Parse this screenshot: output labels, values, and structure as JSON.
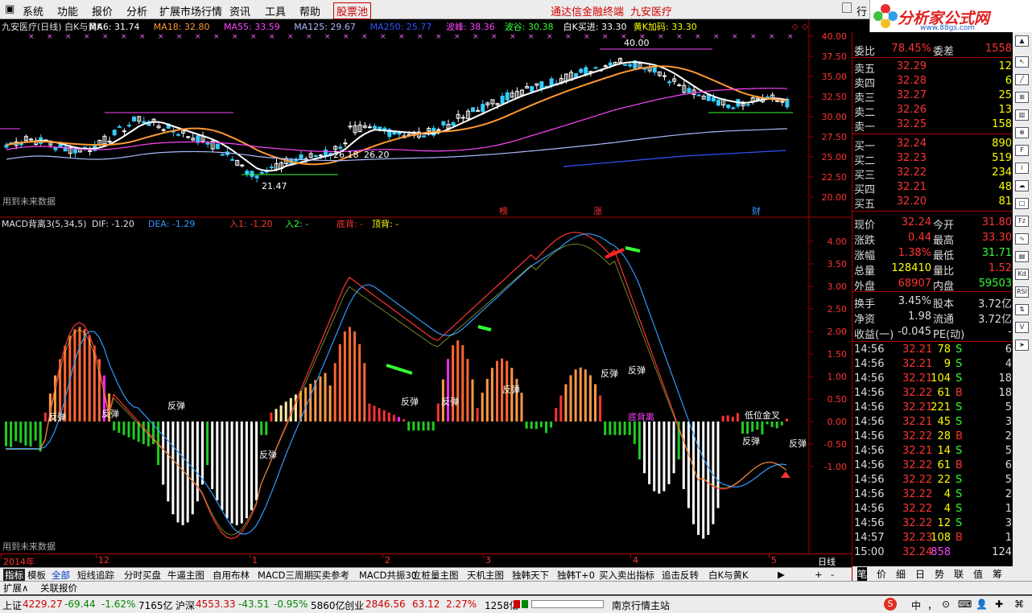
{
  "menu": [
    "系统",
    "功能",
    "报价",
    "分析",
    "扩展市场行情",
    "资讯",
    "工具",
    "帮助",
    "股票池"
  ],
  "menu_center": "通达信金融终端",
  "menu_stock": "九安医疗",
  "menu_right": "行",
  "logo": {
    "text": "分析家公式网",
    "sub": "www.88gs.com"
  },
  "price_header": [
    {
      "t": "九安医疗(日线) 白K与黄K",
      "c": "#e0e0e0"
    },
    {
      "t": "MA6: 31.74",
      "c": "#ffffff"
    },
    {
      "t": "MA18: 32.80",
      "c": "#ff9933"
    },
    {
      "t": "MA55: 33.59",
      "c": "#ff44ff"
    },
    {
      "t": "MA125: 29.67",
      "c": "#aabbff"
    },
    {
      "t": "MA250: 25.77",
      "c": "#3355ff"
    },
    {
      "t": "波峰: 38.36",
      "c": "#ff44ff"
    },
    {
      "t": "波谷: 30.38",
      "c": "#33ff33"
    },
    {
      "t": "白K买进: 33.30",
      "c": "#ffffff"
    },
    {
      "t": "黄K加码: 33.30",
      "c": "#ffff00"
    }
  ],
  "price_axis": [
    "40.00",
    "37.50",
    "35.00",
    "32.50",
    "30.00",
    "27.50",
    "25.00",
    "22.50",
    "20.00"
  ],
  "price_annotations": {
    "high": "40.00",
    "low": "21.47",
    "mid1": "26.18",
    "mid2": "26.20",
    "future": "用到未来数据",
    "b1": "榜",
    "b2": "涨",
    "b3": "财"
  },
  "macd_header": [
    {
      "t": "MACD背离3(5,34,5)",
      "c": "#e0e0e0"
    },
    {
      "t": "DIF: -1.20",
      "c": "#e0e0e0"
    },
    {
      "t": "DEA: -1.29",
      "c": "#3399ff"
    },
    {
      "t": "入1: -1.20",
      "c": "#ff3333"
    },
    {
      "t": "入2: -",
      "c": "#33ff33"
    },
    {
      "t": "底背: -",
      "c": "#ff3333"
    },
    {
      "t": "顶背: -",
      "c": "#ffff00"
    }
  ],
  "macd_axis": [
    "4.00",
    "3.50",
    "3.00",
    "2.50",
    "2.00",
    "1.50",
    "1.00",
    "0.50",
    "0.00",
    "-0.50",
    "-1.00"
  ],
  "macd_annotations": {
    "rebound": "反弹",
    "bottom": "底背离",
    "golden": "低位金叉",
    "future": "用到未来数据"
  },
  "date_axis": [
    "2014年",
    "12",
    "1",
    "2",
    "3",
    "4",
    "5"
  ],
  "period": "日线",
  "quote": {
    "wei_bi_label": "委比",
    "wei_bi": "78.45%",
    "wei_cha_label": "委差",
    "wei_cha": "1558",
    "asks": [
      {
        "l": "卖五",
        "p": "32.29",
        "v": "12"
      },
      {
        "l": "卖四",
        "p": "32.28",
        "v": "6"
      },
      {
        "l": "卖三",
        "p": "32.27",
        "v": "25"
      },
      {
        "l": "卖二",
        "p": "32.26",
        "v": "13"
      },
      {
        "l": "卖一",
        "p": "32.25",
        "v": "158"
      }
    ],
    "bids": [
      {
        "l": "买一",
        "p": "32.24",
        "v": "890"
      },
      {
        "l": "买二",
        "p": "32.23",
        "v": "519"
      },
      {
        "l": "买三",
        "p": "32.22",
        "v": "234"
      },
      {
        "l": "买四",
        "p": "32.21",
        "v": "48"
      },
      {
        "l": "买五",
        "p": "32.20",
        "v": "81"
      }
    ],
    "stats": [
      {
        "l1": "现价",
        "v1": "32.24",
        "c1": "#ff3333",
        "l2": "今开",
        "v2": "31.80",
        "c2": "#ff3333"
      },
      {
        "l1": "涨跌",
        "v1": "0.44",
        "c1": "#ff3333",
        "l2": "最高",
        "v2": "33.30",
        "c2": "#ff3333"
      },
      {
        "l1": "涨幅",
        "v1": "1.38%",
        "c1": "#ff3333",
        "l2": "最低",
        "v2": "31.71",
        "c2": "#33ff33"
      },
      {
        "l1": "总量",
        "v1": "128410",
        "c1": "#ffff00",
        "l2": "量比",
        "v2": "1.52",
        "c2": "#ff3333"
      },
      {
        "l1": "外盘",
        "v1": "68907",
        "c1": "#ff3333",
        "l2": "内盘",
        "v2": "59503",
        "c2": "#33ff33"
      }
    ],
    "stats2": [
      {
        "l1": "换手",
        "v1": "3.45%",
        "l2": "股本",
        "v2": "3.72亿"
      },
      {
        "l1": "净资",
        "v1": "1.98",
        "l2": "流通",
        "v2": "3.72亿"
      },
      {
        "l1": "收益(一)",
        "v1": "-0.045",
        "l2": "PE(动)",
        "v2": "-"
      }
    ],
    "ticks": [
      {
        "t": "14:56",
        "p": "32.21",
        "v": "78",
        "d": "S",
        "n": "6"
      },
      {
        "t": "14:56",
        "p": "32.21",
        "v": "9",
        "d": "S",
        "n": "4"
      },
      {
        "t": "14:56",
        "p": "32.21",
        "v": "104",
        "d": "S",
        "n": "18"
      },
      {
        "t": "14:56",
        "p": "32.22",
        "v": "61",
        "d": "B",
        "n": "18"
      },
      {
        "t": "14:56",
        "p": "32.21",
        "v": "221",
        "d": "S",
        "n": "5"
      },
      {
        "t": "14:56",
        "p": "32.21",
        "v": "45",
        "d": "S",
        "n": "3"
      },
      {
        "t": "14:56",
        "p": "32.22",
        "v": "28",
        "d": "B",
        "n": "2"
      },
      {
        "t": "14:56",
        "p": "32.21",
        "v": "14",
        "d": "S",
        "n": "5"
      },
      {
        "t": "14:56",
        "p": "32.22",
        "v": "61",
        "d": "B",
        "n": "6"
      },
      {
        "t": "14:56",
        "p": "32.22",
        "v": "22",
        "d": "S",
        "n": "5"
      },
      {
        "t": "14:56",
        "p": "32.22",
        "v": "4",
        "d": "S",
        "n": "2"
      },
      {
        "t": "14:56",
        "p": "32.22",
        "v": "4",
        "d": "S",
        "n": "1"
      },
      {
        "t": "14:56",
        "p": "32.22",
        "v": "12",
        "d": "S",
        "n": "3"
      },
      {
        "t": "14:57",
        "p": "32.23",
        "v": "108",
        "d": "B",
        "n": "1"
      },
      {
        "t": "15:00",
        "p": "32.24",
        "v": "858",
        "d": "",
        "n": "124"
      }
    ],
    "bottom_tabs": [
      "笔",
      "价",
      "细",
      "日",
      "势",
      "联",
      "值",
      "筹"
    ]
  },
  "tabs": [
    "指标",
    "模板",
    "全部",
    "短线追踪",
    "分时买盘",
    "牛逼主图",
    "自用布林",
    "MACD三周期",
    "买卖参考",
    "MACD共振30",
    "立桩量主图",
    "天机主图",
    "独韩天下",
    "独韩T+0",
    "买入卖出指标",
    "追击反转",
    "白K与黄K"
  ],
  "tabs_extra": [
    "+",
    "-"
  ],
  "subtabs": [
    "扩展∧",
    "关联报价"
  ],
  "status": {
    "sh_label": "上证",
    "sh": "4229.27",
    "sh_chg": "-69.44",
    "sh_pct": "-1.62%",
    "sh_amt": "7165亿",
    "sz_label": "沪深",
    "sz": "4553.33",
    "sz_chg": "-43.51",
    "sz_pct": "-0.95%",
    "sz_amt": "5860亿",
    "cy_label": "创业",
    "cy": "2846.56",
    "cy_chg": "63.12",
    "cy_pct": "2.27%",
    "cy_amt": "1258亿",
    "server": "南京行情主站",
    "tray": [
      "中",
      "，",
      "⊙",
      "⌨",
      "👤",
      "✚",
      "⌘"
    ]
  }
}
